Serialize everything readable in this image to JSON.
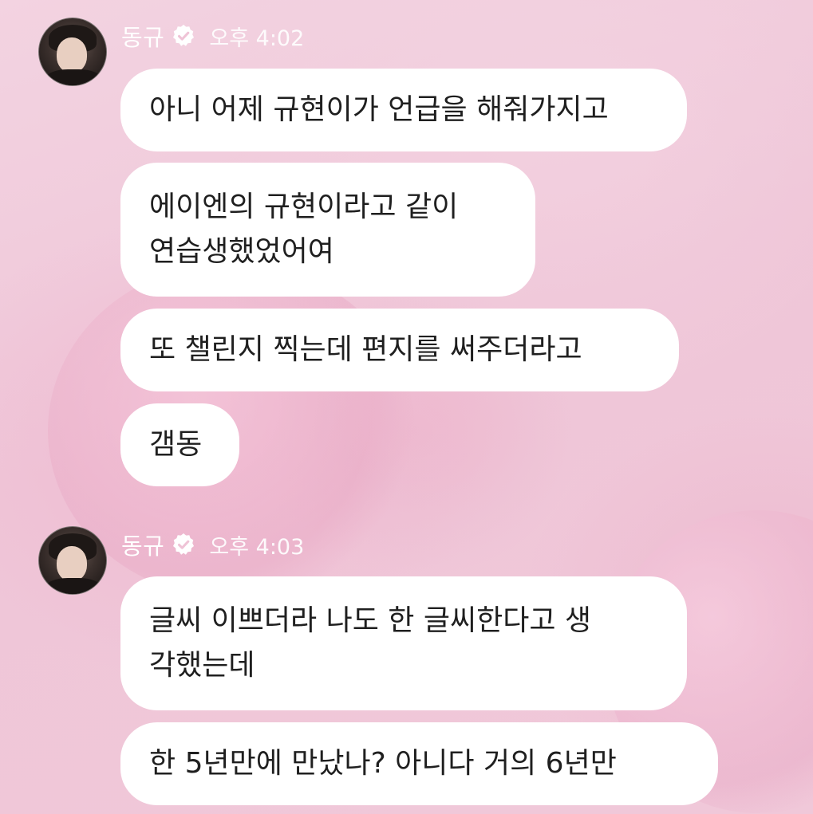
{
  "messages": [
    {
      "sender": "동규",
      "time": "오후 4:02",
      "bubbles": [
        {
          "lines": [
            "아니 어제 규현이가 언급을 해줘가지고"
          ]
        },
        {
          "lines": [
            "에이엔의 규현이라고 같이",
            "연습생했었어여"
          ]
        },
        {
          "lines": [
            "또 챌린지 찍는데 편지를 써주더라고"
          ]
        },
        {
          "lines": [
            "갬동"
          ]
        }
      ]
    },
    {
      "sender": "동규",
      "time": "오후 4:03",
      "bubbles": [
        {
          "lines": [
            "글씨 이쁘더라 나도 한 글씨한다고 생",
            "각했는데"
          ]
        },
        {
          "lines": [
            "한 5년만에 만났나? 아니다 거의 6년만"
          ]
        }
      ]
    }
  ],
  "icons": {
    "verified": "verified-badge-icon",
    "avatar": "avatar"
  },
  "colors": {
    "background": "#f0c9d9",
    "bubble": "#ffffff",
    "text": "#1f1f1f",
    "header_text": "#ffffff"
  }
}
